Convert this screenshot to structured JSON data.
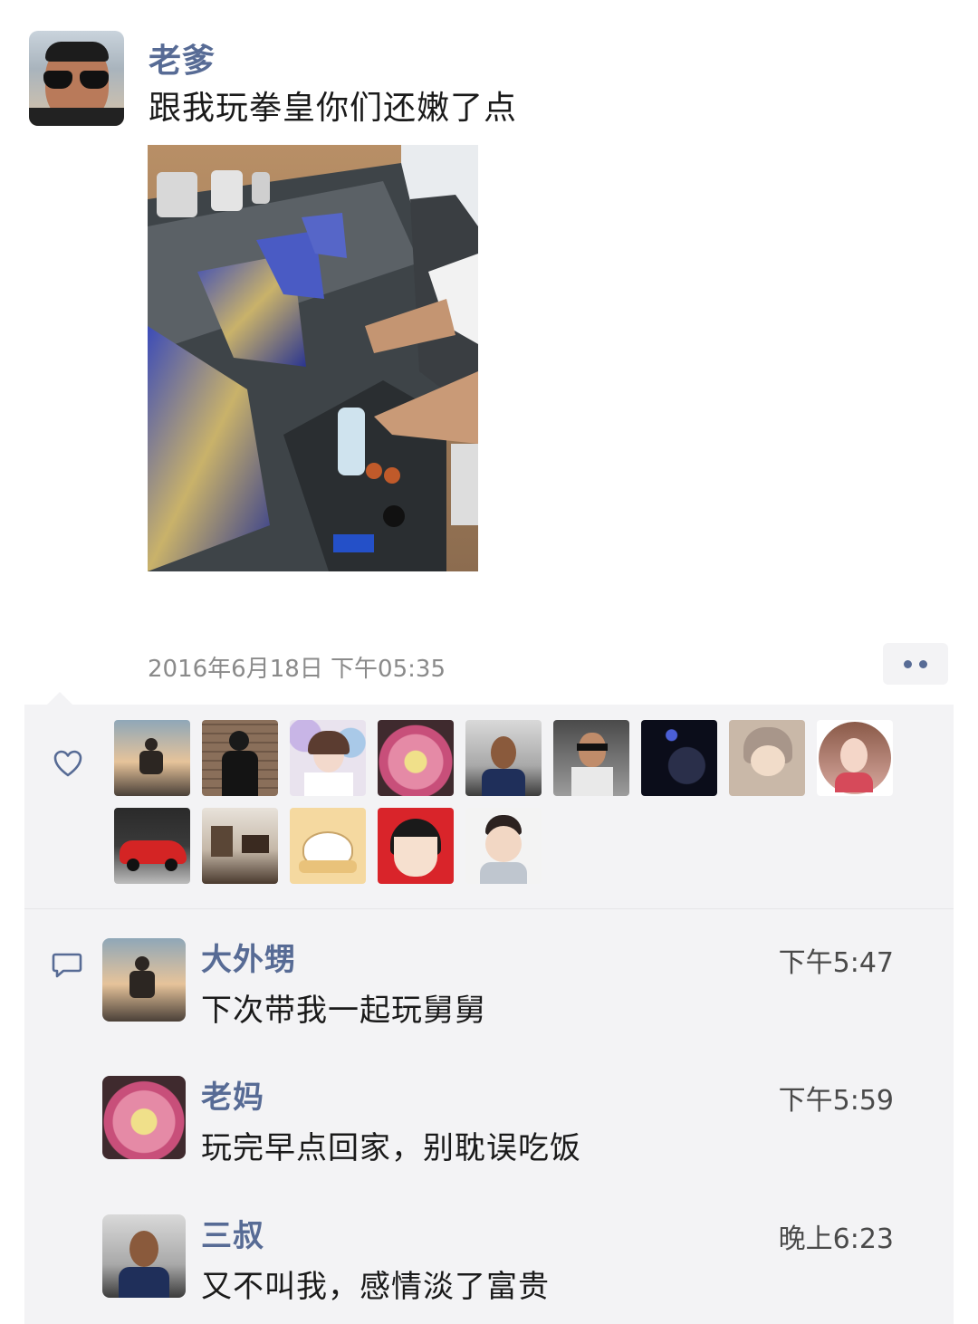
{
  "post": {
    "author_name": "老爹",
    "text": "跟我玩拳皇你们还嫩了点",
    "timestamp": "2016年6月18日 下午05:35"
  },
  "icons": {
    "like": "heart-outline-icon",
    "comment": "comment-bubble-icon",
    "more": "more-dots-icon"
  },
  "colors": {
    "name_link": "#576b95",
    "panel_bg": "#f3f3f5"
  },
  "likes": [
    {
      "avatar": "avatar-sunset-sitting-person"
    },
    {
      "avatar": "avatar-person-brick-wall"
    },
    {
      "avatar": "avatar-girl-flowers"
    },
    {
      "avatar": "avatar-lotus-flower"
    },
    {
      "avatar": "avatar-man-garage"
    },
    {
      "avatar": "avatar-man-sunglasses-car"
    },
    {
      "avatar": "avatar-dark-night"
    },
    {
      "avatar": "avatar-baby-hat"
    },
    {
      "avatar": "avatar-woman-circle"
    },
    {
      "avatar": "avatar-red-sports-car"
    },
    {
      "avatar": "avatar-room-interior"
    },
    {
      "avatar": "avatar-cartoon-cat"
    },
    {
      "avatar": "avatar-cartoon-girl-red"
    },
    {
      "avatar": "avatar-little-boy"
    }
  ],
  "comments": [
    {
      "name": "大外甥",
      "time": "下午5:47",
      "text": "下次带我一起玩舅舅",
      "avatar": "avatar-sunset-sitting-person"
    },
    {
      "name": "老妈",
      "time": "下午5:59",
      "text": "玩完早点回家，别耽误吃饭",
      "avatar": "avatar-lotus-flower"
    },
    {
      "name": "三叔",
      "time": "晚上6:23",
      "text": "又不叫我，感情淡了富贵",
      "avatar": "avatar-man-garage"
    }
  ]
}
